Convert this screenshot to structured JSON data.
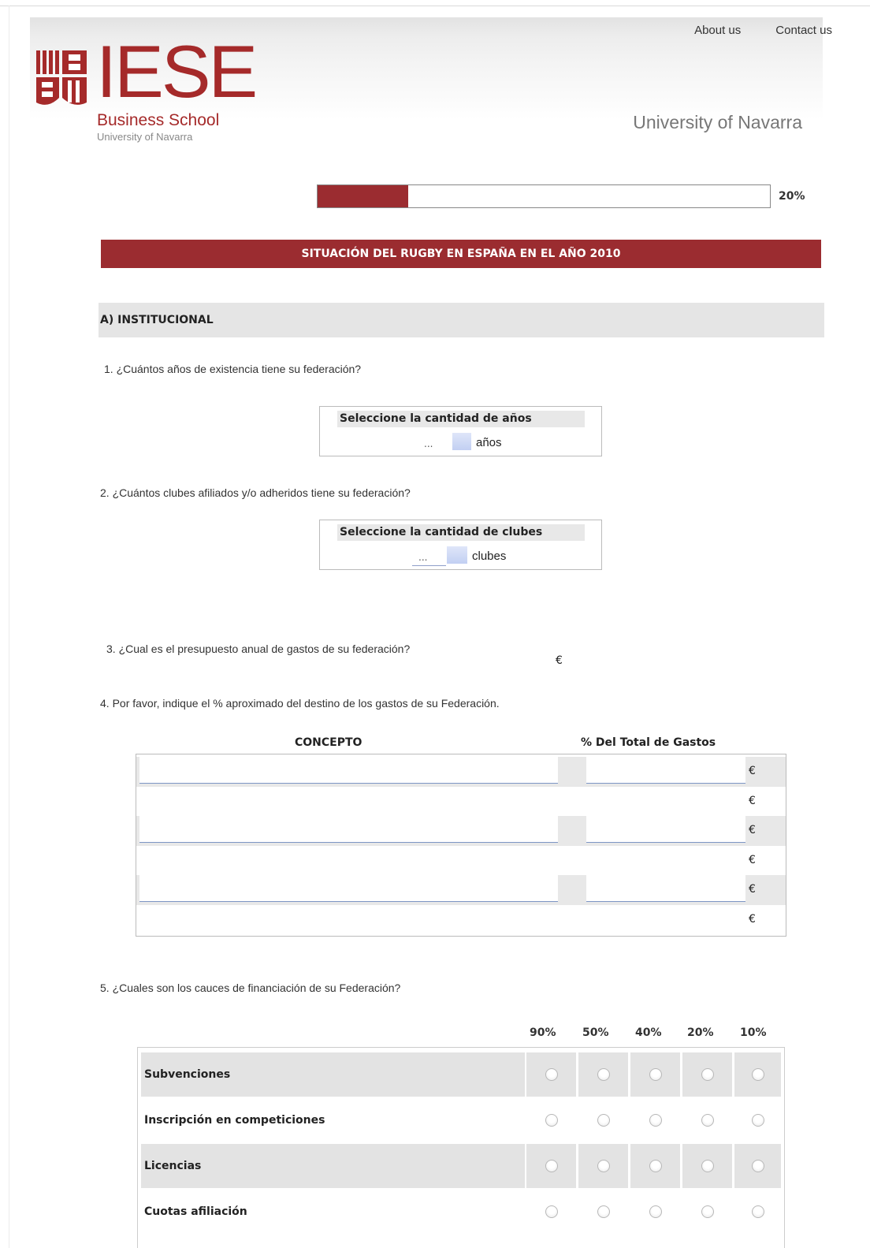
{
  "nav": {
    "about": "About us",
    "contact": "Contact us"
  },
  "brand": {
    "name": "IESE",
    "subtitle": "Business School",
    "university_small": "University of Navarra",
    "university": "University of Navarra",
    "color": "#9b2c30"
  },
  "progress": {
    "percent": 20,
    "label": "20%"
  },
  "banner": {
    "title": "SITUACIÓN DEL RUGBY EN ESPAÑA EN EL AÑO 2010"
  },
  "section": {
    "title": "A) INSTITUCIONAL"
  },
  "q1": {
    "text": "1. ¿Cuántos años de existencia tiene su federación?",
    "box_title": "Seleccione la cantidad de años",
    "value": "...",
    "unit": "años"
  },
  "q2": {
    "text": "2. ¿Cuántos clubes afiliados y/o adheridos tiene su federación?",
    "box_title": "Seleccione la cantidad de clubes",
    "value": "...",
    "unit": "clubes"
  },
  "q3": {
    "text": "3. ¿Cual es el presupuesto anual de gastos de su federación?",
    "currency": "€"
  },
  "q4": {
    "text": "4. Por favor, indique el % aproximado del destino de los gastos de su Federación.",
    "col_concept": "CONCEPTO",
    "col_percent": "% Del Total de Gastos",
    "currency": "€"
  },
  "q5": {
    "text": "5. ¿Cuales son los cauces de financiación de su Federación?",
    "options": [
      "90%",
      "50%",
      "40%",
      "20%",
      "10%"
    ],
    "rows": [
      "Subvenciones",
      "Inscripción en competiciones",
      "Licencias",
      "Cuotas afiliación"
    ]
  }
}
